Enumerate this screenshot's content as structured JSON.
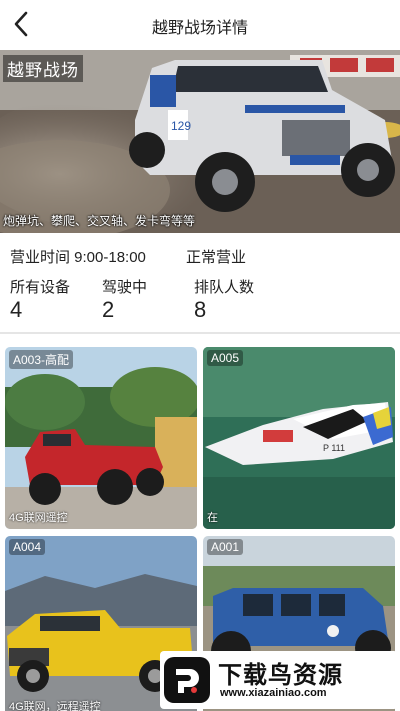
{
  "header": {
    "title": "越野战场详情",
    "back_icon": "chevron-left-icon"
  },
  "hero": {
    "name": "越野战场",
    "tags": "炮弹坑、攀爬、交叉轴、发卡弯等等",
    "image": "offroad-truck-photo"
  },
  "info": {
    "hours": "营业时间  9:00-18:00",
    "status": "正常营业"
  },
  "stats": [
    {
      "label": "所有设备",
      "value": "4"
    },
    {
      "label": "驾驶中",
      "value": "2"
    },
    {
      "label": "排队人数",
      "value": "8"
    }
  ],
  "devices": [
    {
      "code": "A003-高配",
      "desc": "4G联网遥控",
      "image": "red-jeep-photo"
    },
    {
      "code": "A005",
      "desc": "在",
      "image": "rc-boat-photo"
    },
    {
      "code": "A004",
      "desc": "4G联网，远程遥控",
      "image": "yellow-pickup-photo"
    },
    {
      "code": "A001",
      "desc": "",
      "image": "blue-jeep-photo"
    }
  ],
  "watermark": {
    "title": "下载鸟资源",
    "url": "www.xiazainiao.com"
  }
}
